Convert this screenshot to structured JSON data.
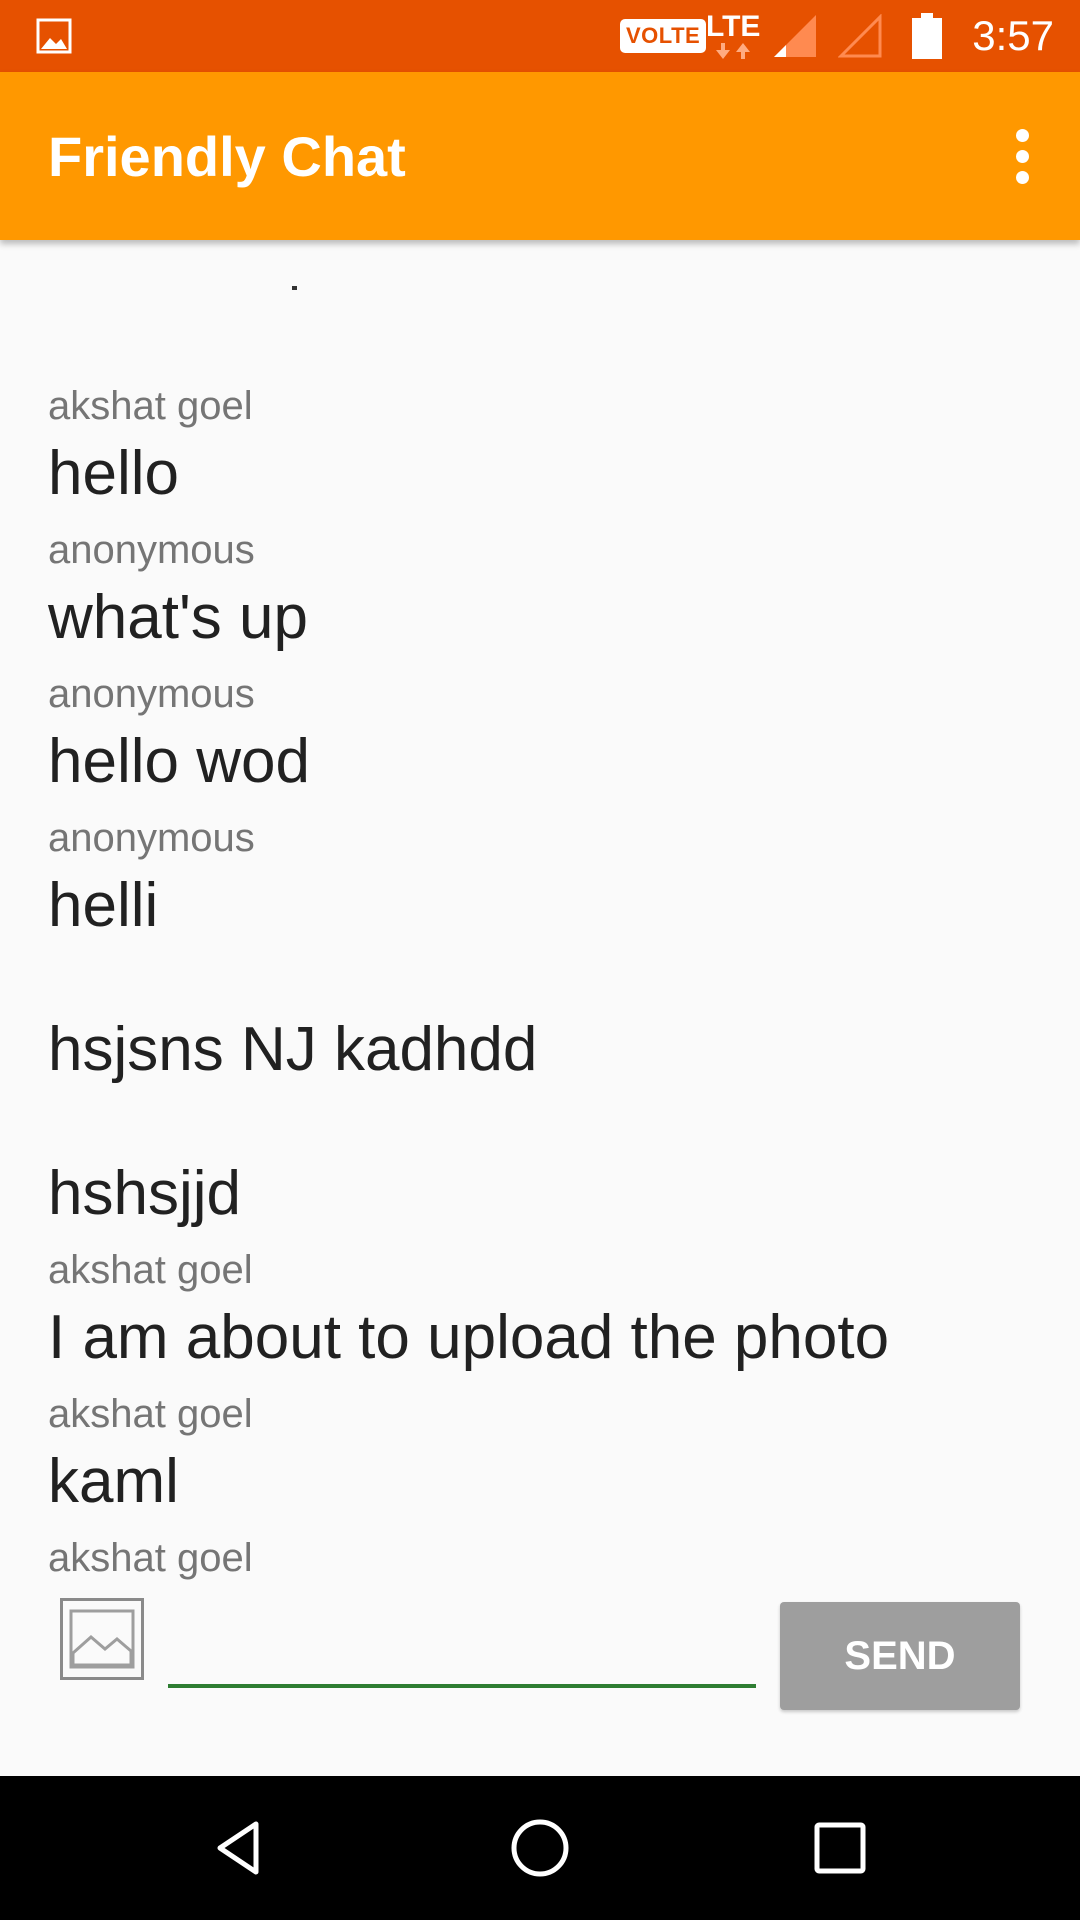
{
  "status_bar": {
    "time": "3:57",
    "volte": "VOLTE",
    "network": "LTE",
    "icons": [
      "image-notification-icon",
      "volte-icon",
      "lte-data-icon",
      "signal-icon",
      "signal-empty-icon",
      "battery-icon"
    ]
  },
  "app_bar": {
    "title": "Friendly Chat",
    "menu_icon": "overflow-menu-icon"
  },
  "messages": [
    {
      "author": "akshat goel",
      "text": "hello"
    },
    {
      "author": "anonymous",
      "text": "what's up"
    },
    {
      "author": "anonymous",
      "text": "hello wod"
    },
    {
      "author": "anonymous",
      "text": "helli"
    },
    {
      "author": "",
      "text": "hsjsns NJ kadhdd"
    },
    {
      "author": "",
      "text": "hshsjjd"
    },
    {
      "author": "akshat goel",
      "text": "I am about to upload the photo"
    },
    {
      "author": "akshat goel",
      "text": "kaml"
    },
    {
      "author": "akshat goel",
      "text": ""
    }
  ],
  "composer": {
    "photo_icon": "image-picker-icon",
    "input_value": "",
    "send_label": "SEND"
  },
  "nav_bar": {
    "icons": [
      "back-icon",
      "home-icon",
      "recents-icon"
    ]
  },
  "colors": {
    "status_bar": "#e65100",
    "app_bar": "#ff9800",
    "send_button": "#9e9e9e",
    "input_underline": "#2e7d32"
  }
}
